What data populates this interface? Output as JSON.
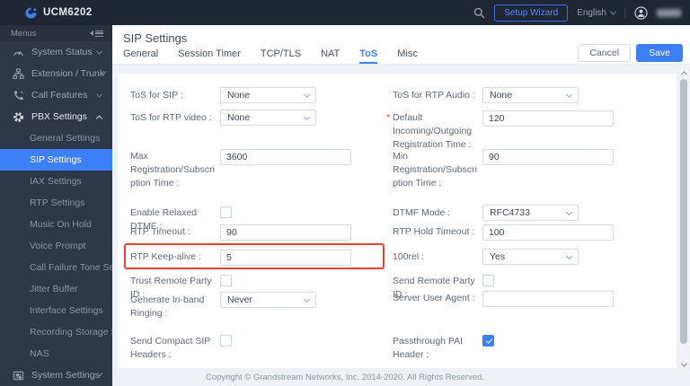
{
  "topbar": {
    "brand": "UCM6202",
    "logo_icon": "grandstream-logo-icon",
    "search_icon": "search-icon",
    "setup_wizard_label": "Setup Wizard",
    "language_label": "English",
    "user_icon": "user-avatar-icon",
    "username_blurred": true
  },
  "sidebar": {
    "menus_label": "Menus",
    "active_item": "SIP Settings",
    "sections": [
      {
        "label": "System Status",
        "icon": "gauge-icon",
        "state": "collapsed"
      },
      {
        "label": "Extension / Trunk",
        "icon": "sitemap-icon",
        "state": "collapsed"
      },
      {
        "label": "Call Features",
        "icon": "phone-icon",
        "state": "collapsed"
      },
      {
        "label": "PBX Settings",
        "icon": "gear-icon",
        "state": "expanded",
        "children": [
          "General Settings",
          "SIP Settings",
          "IAX Settings",
          "RTP Settings",
          "Music On Hold",
          "Voice Prompt",
          "Call Failure Tone Set...",
          "Jitter Buffer",
          "Interface Settings",
          "Recording Storage S...",
          "NAS"
        ]
      },
      {
        "label": "System Settings",
        "icon": "sliders-icon",
        "state": "collapsed"
      }
    ]
  },
  "page": {
    "title": "SIP Settings",
    "tabs": [
      "General",
      "Session Timer",
      "TCP/TLS",
      "NAT",
      "ToS",
      "Misc"
    ],
    "active_tab": "ToS",
    "cancel_label": "Cancel",
    "save_label": "Save"
  },
  "form": {
    "required_marker": "*",
    "left": [
      {
        "label": "ToS for SIP :",
        "type": "select",
        "value": "None"
      },
      {
        "label": "ToS for RTP video :",
        "type": "select",
        "value": "None"
      },
      {
        "label": "Max Registration/Subscription Time :",
        "type": "input",
        "value": "3600"
      },
      {
        "label": "Enable Relaxed DTMF :",
        "type": "checkbox",
        "checked": false
      },
      {
        "label": "RTP Timeout :",
        "type": "input",
        "value": "90"
      },
      {
        "label": "RTP Keep-alive :",
        "type": "input",
        "value": "5",
        "highlighted": true
      },
      {
        "label": "Trust Remote Party ID :",
        "type": "checkbox",
        "checked": false
      },
      {
        "label": "Generate In-band Ringing :",
        "type": "select",
        "value": "Never"
      },
      {
        "label": "Send Compact SIP Headers :",
        "type": "checkbox",
        "checked": false
      }
    ],
    "right": [
      {
        "label": "ToS for RTP Audio :",
        "type": "select",
        "value": "None"
      },
      {
        "label": "Default Incoming/Outgoing Registration Time :",
        "type": "input",
        "value": "120",
        "required": true
      },
      {
        "label": "Min Registration/Subscription Time :",
        "type": "input",
        "value": "90"
      },
      {
        "label": "DTMF Mode :",
        "type": "select",
        "value": "RFC4733"
      },
      {
        "label": "RTP Hold Timeout :",
        "type": "input",
        "value": "100"
      },
      {
        "label": "100rel :",
        "type": "select",
        "value": "Yes"
      },
      {
        "label": "Send Remote Party ID :",
        "type": "checkbox",
        "checked": false
      },
      {
        "label": "Server User Agent :",
        "type": "input",
        "value": ""
      },
      {
        "label": "Passthrough PAI Header :",
        "type": "checkbox",
        "checked": true
      }
    ]
  },
  "footer": {
    "copyright": "Copyright © Grandstream Networks, Inc. 2014-2020. All Rights Reserved."
  },
  "colors": {
    "accent_blue": "#3D7EF5",
    "selected_item_blue": "#3E80F8",
    "highlight_red": "#E0433D",
    "topbar_bg": "#1E2634",
    "sidebar_bg": "#2E3747",
    "page_bg": "#EEF1F6",
    "label_gray": "#5D6878"
  }
}
